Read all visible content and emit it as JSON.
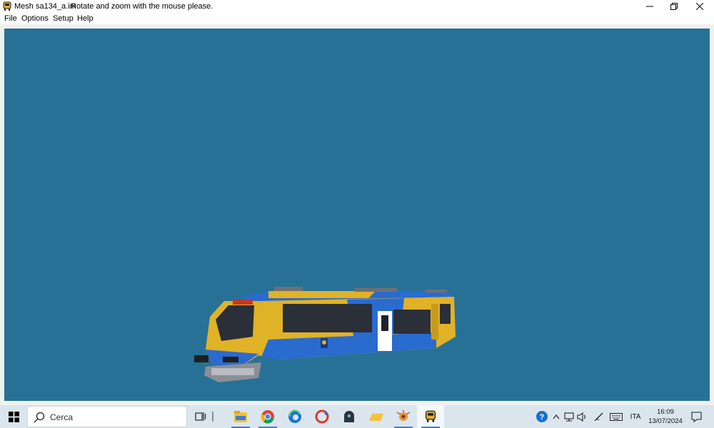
{
  "window": {
    "title": "Mesh sa134_a.im",
    "hint": "Rotate and zoom with the mouse please.",
    "app_icon": "train-app-icon",
    "controls": [
      "minimize-icon",
      "restore-icon",
      "close-icon"
    ]
  },
  "menu": {
    "file": "File",
    "options": "Options",
    "setup": "Setup",
    "help": "Help"
  },
  "viewport": {
    "background": "#287196",
    "model_colors": {
      "blue": "#2a6bd0",
      "yellow": "#e0b227",
      "window": "#2a2f38"
    }
  },
  "taskbar": {
    "search_placeholder": "Cerca",
    "apps": [
      "task-view-icon",
      "file-explorer-icon",
      "chrome-icon",
      "edge-icon",
      "ccleaner-icon",
      "dark-app-icon",
      "folder-yellow-icon",
      "tray-app-icon",
      "train-app-icon"
    ],
    "tray": {
      "language": "ITA",
      "icons": [
        "help-icon",
        "chevron-up-icon",
        "network-icon",
        "volume-icon",
        "pen-icon",
        "keyboard-icon",
        "notification-icon"
      ]
    },
    "clock": {
      "time": "16:09",
      "date": "13/07/2024"
    }
  }
}
